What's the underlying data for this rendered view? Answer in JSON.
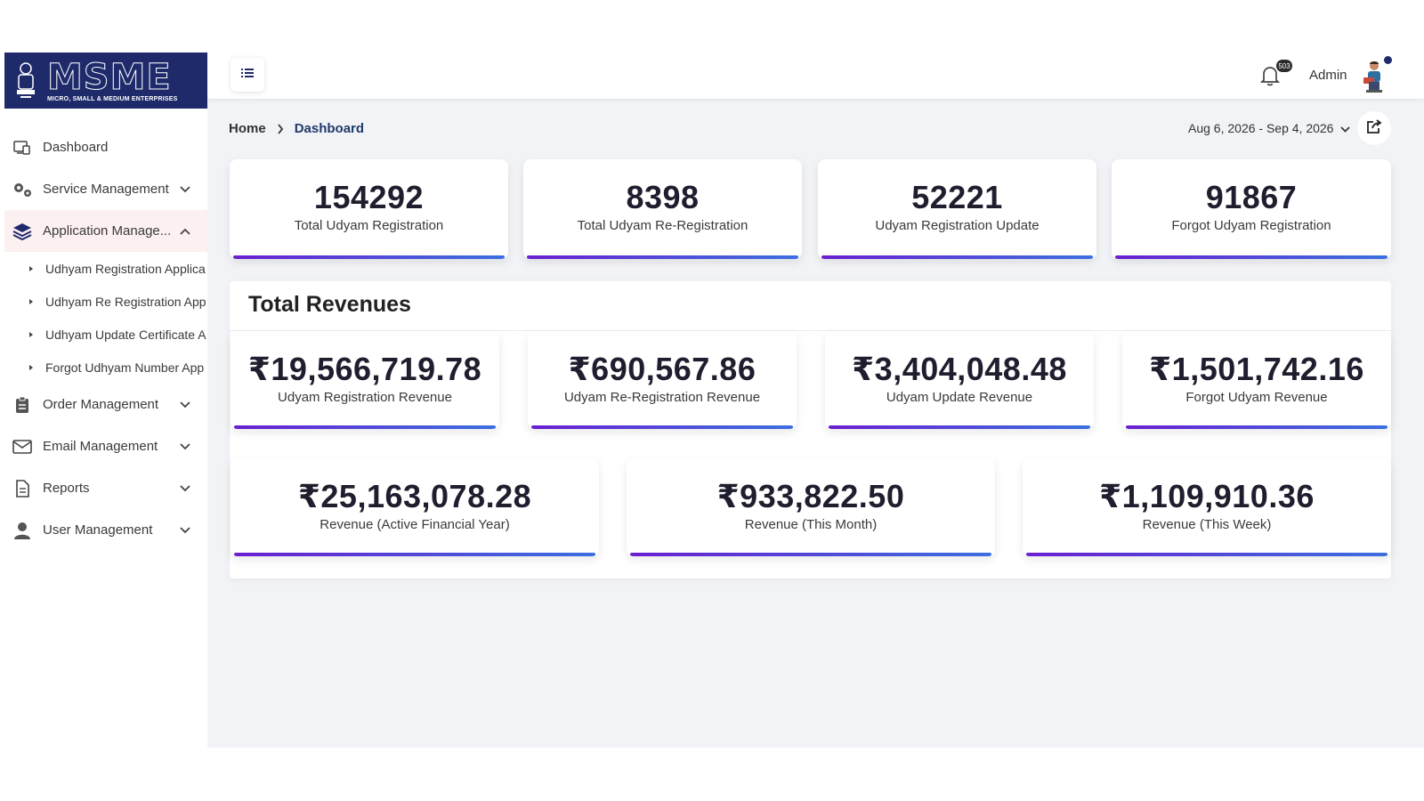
{
  "logo": {
    "title": "MSME",
    "subtitle": "MICRO, SMALL & MEDIUM ENTERPRISES"
  },
  "sidebar": {
    "items": [
      {
        "label": "Dashboard",
        "icon": "dashboard-icon"
      },
      {
        "label": "Service Management",
        "icon": "gears-icon"
      },
      {
        "label": "Application Manage...",
        "icon": "layers-icon"
      },
      {
        "label": "Order Management",
        "icon": "clipboard-icon"
      },
      {
        "label": "Email Management",
        "icon": "envelope-icon"
      },
      {
        "label": "Reports",
        "icon": "document-icon"
      },
      {
        "label": "User Management",
        "icon": "user-icon"
      }
    ],
    "sub_items": [
      "Udhyam Registration Applica",
      "Udhyam Re Registration App",
      "Udhyam Update Certificate A",
      "Forgot Udhyam Number App"
    ]
  },
  "header": {
    "notification_count": "503",
    "admin_name": "Admin"
  },
  "breadcrumb": {
    "home": "Home",
    "current": "Dashboard"
  },
  "date_range": "Aug 6, 2026 - Sep 4, 2026",
  "stats": [
    {
      "value": "154292",
      "label": "Total Udyam Registration"
    },
    {
      "value": "8398",
      "label": "Total Udyam Re-Registration"
    },
    {
      "value": "52221",
      "label": "Udyam Registration Update"
    },
    {
      "value": "91867",
      "label": "Forgot Udyam Registration"
    }
  ],
  "revenues": {
    "title": "Total Revenues",
    "row1": [
      {
        "value": "₹19,566,719.78",
        "label": "Udyam Registration Revenue"
      },
      {
        "value": "₹690,567.86",
        "label": "Udyam Re-Registration Revenue"
      },
      {
        "value": "₹3,404,048.48",
        "label": "Udyam Update Revenue"
      },
      {
        "value": "₹1,501,742.16",
        "label": "Forgot Udyam Revenue"
      }
    ],
    "row2": [
      {
        "value": "₹25,163,078.28",
        "label": "Revenue (Active Financial Year)"
      },
      {
        "value": "₹933,822.50",
        "label": "Revenue (This Month)"
      },
      {
        "value": "₹1,109,910.36",
        "label": "Revenue (This Week)"
      }
    ]
  },
  "colors": {
    "brand": "#1f2a6b",
    "accent_gradient_start": "#6a1fd1",
    "accent_gradient_end": "#3b6fe0",
    "active_bg": "#fdf0f0"
  }
}
